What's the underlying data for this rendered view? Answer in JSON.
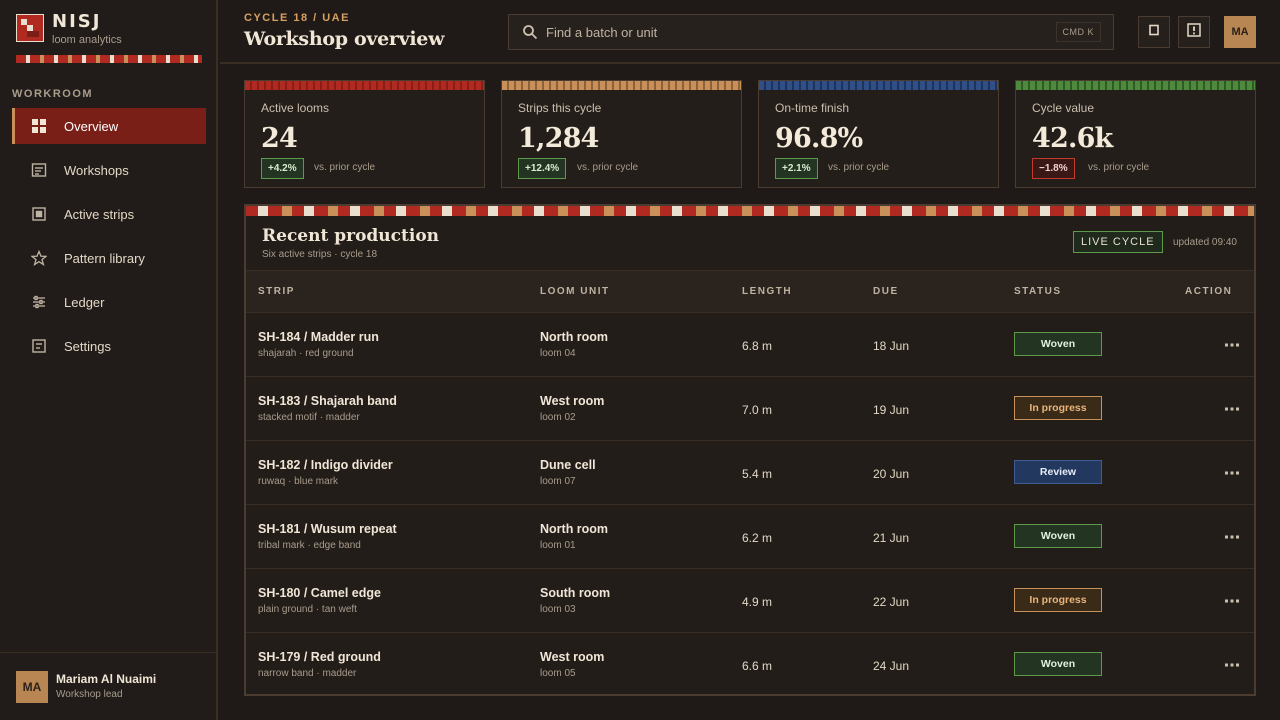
{
  "brand": {
    "name": "NISJ",
    "subtitle": "loom analytics"
  },
  "sidebar": {
    "heading": "WORKROOM",
    "items": [
      {
        "label": "Overview",
        "icon": "grid-icon",
        "active": true
      },
      {
        "label": "Workshops",
        "icon": "workshop-icon",
        "active": false
      },
      {
        "label": "Active strips",
        "icon": "square-icon",
        "active": false
      },
      {
        "label": "Pattern library",
        "icon": "star-icon",
        "active": false
      },
      {
        "label": "Ledger",
        "icon": "sliders-icon",
        "active": false
      },
      {
        "label": "Settings",
        "icon": "settings-icon",
        "active": false
      }
    ],
    "user": {
      "initials": "MA",
      "name": "Mariam Al Nuaimi",
      "role": "Workshop lead"
    }
  },
  "header": {
    "breadcrumb": "CYCLE 18 / UAE",
    "title": "Workshop overview",
    "search": {
      "placeholder": "Find a batch or unit",
      "shortcut": "CMD K"
    },
    "avatar": "MA"
  },
  "stats": [
    {
      "label": "Active looms",
      "value": "24",
      "delta": "+4.2%",
      "trend": "up",
      "note": "vs. prior cycle",
      "accent": "#b02a21"
    },
    {
      "label": "Strips this cycle",
      "value": "1,284",
      "delta": "+12.4%",
      "trend": "up",
      "note": "vs. prior cycle",
      "accent": "#c9905a"
    },
    {
      "label": "On-time finish",
      "value": "96.8%",
      "delta": "+2.1%",
      "trend": "up",
      "note": "vs. prior cycle",
      "accent": "#2f4f86"
    },
    {
      "label": "Cycle value",
      "value": "42.6k",
      "delta": "−1.8%",
      "trend": "down",
      "note": "vs. prior cycle",
      "accent": "#4d8a3e"
    }
  ],
  "production": {
    "title": "Recent production",
    "subtitle": "Six active strips · cycle 18",
    "badge": "LIVE CYCLE",
    "updated": "updated 09:40",
    "columns": [
      "STRIP",
      "LOOM UNIT",
      "LENGTH",
      "DUE",
      "STATUS",
      "ACTION"
    ],
    "rows": [
      {
        "strip": "SH-184 / Madder run",
        "pattern": "shajarah · red ground",
        "unit": "North room",
        "loom": "loom 04",
        "length": "6.8 m",
        "due": "18 Jun",
        "status": "Woven",
        "status_kind": "woven"
      },
      {
        "strip": "SH-183 / Shajarah band",
        "pattern": "stacked motif · madder",
        "unit": "West room",
        "loom": "loom 02",
        "length": "7.0 m",
        "due": "19 Jun",
        "status": "In progress",
        "status_kind": "progress"
      },
      {
        "strip": "SH-182 / Indigo divider",
        "pattern": "ruwaq · blue mark",
        "unit": "Dune cell",
        "loom": "loom 07",
        "length": "5.4 m",
        "due": "20 Jun",
        "status": "Review",
        "status_kind": "review"
      },
      {
        "strip": "SH-181 / Wusum repeat",
        "pattern": "tribal mark · edge band",
        "unit": "North room",
        "loom": "loom 01",
        "length": "6.2 m",
        "due": "21 Jun",
        "status": "Woven",
        "status_kind": "woven"
      },
      {
        "strip": "SH-180 / Camel edge",
        "pattern": "plain ground · tan weft",
        "unit": "South room",
        "loom": "loom 03",
        "length": "4.9 m",
        "due": "22 Jun",
        "status": "In progress",
        "status_kind": "progress"
      },
      {
        "strip": "SH-179 / Red ground",
        "pattern": "narrow band · madder",
        "unit": "West room",
        "loom": "loom 05",
        "length": "6.6 m",
        "due": "24 Jun",
        "status": "Woven",
        "status_kind": "woven"
      }
    ]
  }
}
